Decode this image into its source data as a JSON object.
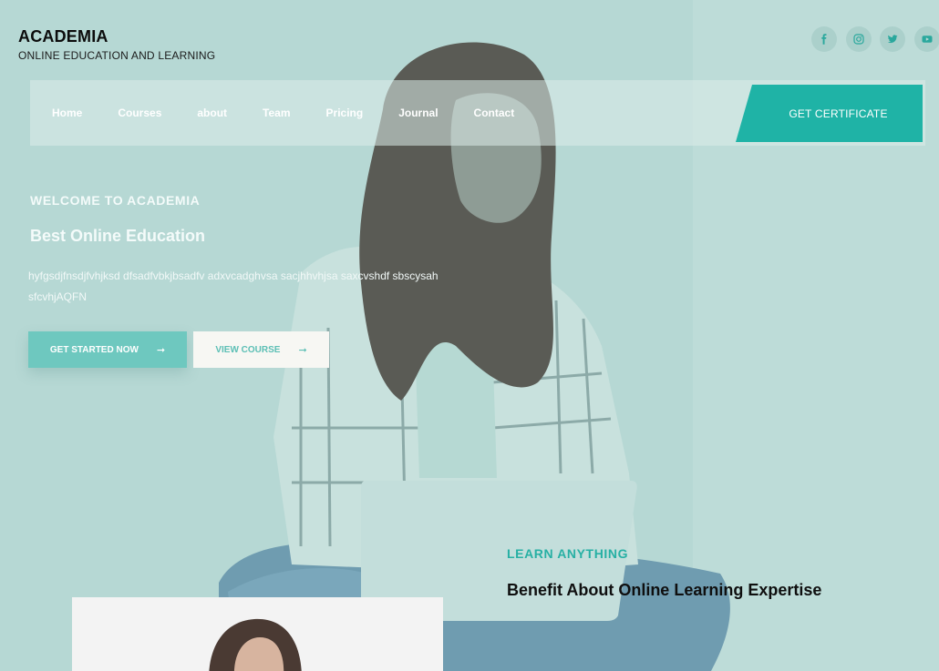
{
  "brand": {
    "title": "ACADEMIA",
    "tagline": "ONLINE EDUCATION AND LEARNING"
  },
  "social": [
    {
      "icon": "facebook-icon"
    },
    {
      "icon": "instagram-icon"
    },
    {
      "icon": "twitter-icon"
    },
    {
      "icon": "youtube-icon"
    }
  ],
  "nav": {
    "items": [
      "Home",
      "Courses",
      "about",
      "Team",
      "Pricing",
      "Journal",
      "Contact"
    ],
    "cta_label": "GET CERTIFICATE"
  },
  "hero": {
    "kicker": "WELCOME TO ACADEMIA",
    "heading": "Best Online Education",
    "description": "hyfgsdjfnsdjfvhjksd dfsadfvbkjbsadfv adxvcadghvsa sacjhhvhjsa saxcvshdf sbscysah sfcvhjAQFN",
    "primary_button": "GET STARTED NOW",
    "secondary_button": "VIEW COURSE",
    "arrow_glyph": "➞"
  },
  "learn": {
    "kicker": "LEARN ANYTHING",
    "heading": "Benefit About Online Learning Expertise"
  },
  "colors": {
    "accent": "#1fb3a6",
    "background": "#b6d8d4"
  }
}
